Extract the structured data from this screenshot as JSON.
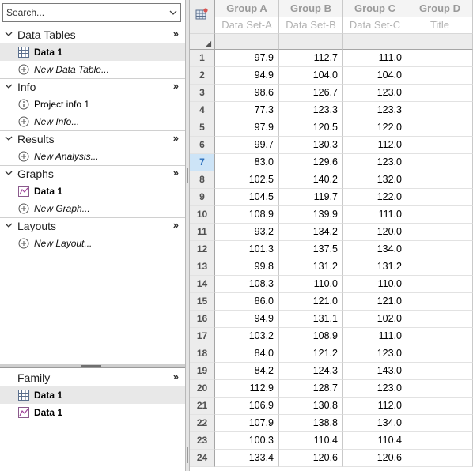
{
  "search": {
    "placeholder": "Search..."
  },
  "sections": [
    {
      "title": "Data Tables",
      "collapse": "»",
      "items": [
        {
          "label": "Data 1",
          "icon": "data-table-icon",
          "style": "bold",
          "selected": true
        },
        {
          "label": "New Data Table...",
          "icon": "add-circle-icon",
          "style": "italic"
        }
      ]
    },
    {
      "title": "Info",
      "collapse": "»",
      "items": [
        {
          "label": "Project info 1",
          "icon": "info-icon",
          "style": "normal"
        },
        {
          "label": "New Info...",
          "icon": "add-circle-icon",
          "style": "italic"
        }
      ]
    },
    {
      "title": "Results",
      "collapse": "»",
      "items": [
        {
          "label": "New Analysis...",
          "icon": "add-circle-icon",
          "style": "italic"
        }
      ]
    },
    {
      "title": "Graphs",
      "collapse": "»",
      "items": [
        {
          "label": "Data 1",
          "icon": "graph-icon",
          "style": "bold"
        },
        {
          "label": "New Graph...",
          "icon": "add-circle-icon",
          "style": "italic"
        }
      ]
    },
    {
      "title": "Layouts",
      "collapse": "»",
      "items": [
        {
          "label": "New Layout...",
          "icon": "add-circle-icon",
          "style": "italic"
        }
      ]
    }
  ],
  "family": {
    "title": "Family",
    "collapse": "»",
    "items": [
      {
        "label": "Data 1",
        "icon": "data-table-icon",
        "selected": true
      },
      {
        "label": "Data 1",
        "icon": "graph-icon"
      }
    ]
  },
  "sheet": {
    "columns": [
      {
        "group": "Group A",
        "sub": "Data Set-A"
      },
      {
        "group": "Group B",
        "sub": "Data Set-B"
      },
      {
        "group": "Group C",
        "sub": "Data Set-C"
      },
      {
        "group": "Group D",
        "sub": "Title"
      }
    ],
    "selected_row": 7,
    "rows": [
      [
        "1",
        "97.9",
        "112.7",
        "111.0",
        ""
      ],
      [
        "2",
        "94.9",
        "104.0",
        "104.0",
        ""
      ],
      [
        "3",
        "98.6",
        "126.7",
        "123.0",
        ""
      ],
      [
        "4",
        "77.3",
        "123.3",
        "123.3",
        ""
      ],
      [
        "5",
        "97.9",
        "120.5",
        "122.0",
        ""
      ],
      [
        "6",
        "99.7",
        "130.3",
        "112.0",
        ""
      ],
      [
        "7",
        "83.0",
        "129.6",
        "123.0",
        ""
      ],
      [
        "8",
        "102.5",
        "140.2",
        "132.0",
        ""
      ],
      [
        "9",
        "104.5",
        "119.7",
        "122.0",
        ""
      ],
      [
        "10",
        "108.9",
        "139.9",
        "111.0",
        ""
      ],
      [
        "11",
        "93.2",
        "134.2",
        "120.0",
        ""
      ],
      [
        "12",
        "101.3",
        "137.5",
        "134.0",
        ""
      ],
      [
        "13",
        "99.8",
        "131.2",
        "131.2",
        ""
      ],
      [
        "14",
        "108.3",
        "110.0",
        "110.0",
        ""
      ],
      [
        "15",
        "86.0",
        "121.0",
        "121.0",
        ""
      ],
      [
        "16",
        "94.9",
        "131.1",
        "102.0",
        ""
      ],
      [
        "17",
        "103.2",
        "108.9",
        "111.0",
        ""
      ],
      [
        "18",
        "84.0",
        "121.2",
        "123.0",
        ""
      ],
      [
        "19",
        "84.2",
        "124.3",
        "143.0",
        ""
      ],
      [
        "20",
        "112.9",
        "128.7",
        "123.0",
        ""
      ],
      [
        "21",
        "106.9",
        "130.8",
        "112.0",
        ""
      ],
      [
        "22",
        "107.9",
        "138.8",
        "134.0",
        ""
      ],
      [
        "23",
        "100.3",
        "110.4",
        "110.4",
        ""
      ],
      [
        "24",
        "133.4",
        "120.6",
        "120.6",
        ""
      ]
    ]
  },
  "colors": {
    "selection_row": "#cde4f7",
    "selected_item": "#e8e8e8",
    "header_text": "#9a9a9a"
  }
}
